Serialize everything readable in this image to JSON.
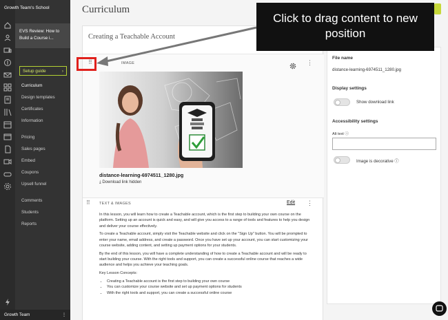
{
  "sidebar": {
    "school_name": "Growth Team's School",
    "course_title": "EVS Review: How to Build a Course i...",
    "setup_guide": "Setup guide",
    "setup_arrow": "›",
    "items": [
      {
        "label": "Curriculum",
        "active": true
      },
      {
        "label": "Design templates"
      },
      {
        "label": "Certificates"
      },
      {
        "label": "Information"
      },
      {
        "label": "Pricing"
      },
      {
        "label": "Sales pages"
      },
      {
        "label": "Embed"
      },
      {
        "label": "Coupons"
      },
      {
        "label": "Upsell funnel"
      },
      {
        "label": "Comments"
      },
      {
        "label": "Students"
      },
      {
        "label": "Reports"
      }
    ],
    "team_name": "Growth Team",
    "team_menu": "⋮"
  },
  "rail_icons": [
    "home-icon",
    "users-icon",
    "sales-icon",
    "dollar-icon",
    "mail-icon",
    "apps-icon",
    "course-icon",
    "library-icon",
    "calendar-icon",
    "site-icon",
    "pages-icon",
    "video-icon",
    "gamepad-icon",
    "settings-icon",
    "bolt-icon"
  ],
  "main": {
    "title": "Curriculum",
    "card_title": "Creating a Teachable Account",
    "image_block": {
      "label": "IMAGE",
      "file_name": "distance-learning-6974511_1280.jpg",
      "download_status": "Download link hidden"
    },
    "text_block": {
      "label": "TEXT & IMAGES",
      "edit": "Edit",
      "paragraphs": [
        "In this lesson, you will learn how to create a Teachable account, which is the first step to building your own course on the platform. Setting up an account is quick and easy, and will give you access to a range of tools and features to help you design and deliver your course effectively.",
        "To create a Teachable account, simply visit the Teachable website and click on the \"Sign Up\" button. You will be prompted to enter your name, email address, and create a password. Once you have set up your account, you can start customizing your course website, adding content, and setting up payment options for your students.",
        "By the end of this lesson, you will have a complete understanding of how to create a Teachable account and will be ready to start building your course. With the right tools and support, you can create a successful online course that reaches a wide audience and helps you achieve your teaching goals.",
        "Key Lesson Concepts:"
      ],
      "bullets": [
        "Creating a Teachable account is the first step to building your own course",
        "You can customize your course website and set up payment options for students",
        "With the right tools and support, you can create a successful online course"
      ]
    }
  },
  "right_panel": {
    "file_name_label": "File name",
    "file_name_value": "distance-learning-6974511_1280.jpg",
    "display_settings": "Display settings",
    "show_download": "Show download link",
    "accessibility": "Accessibility settings",
    "alt_text": "Alt text",
    "image_decorative": "Image is decorative"
  },
  "callout": {
    "text": "Click to drag content to new position"
  },
  "colors": {
    "sidebar_bg": "#333333",
    "accent_green": "#c6d83a",
    "highlight_red": "#e0201c"
  }
}
